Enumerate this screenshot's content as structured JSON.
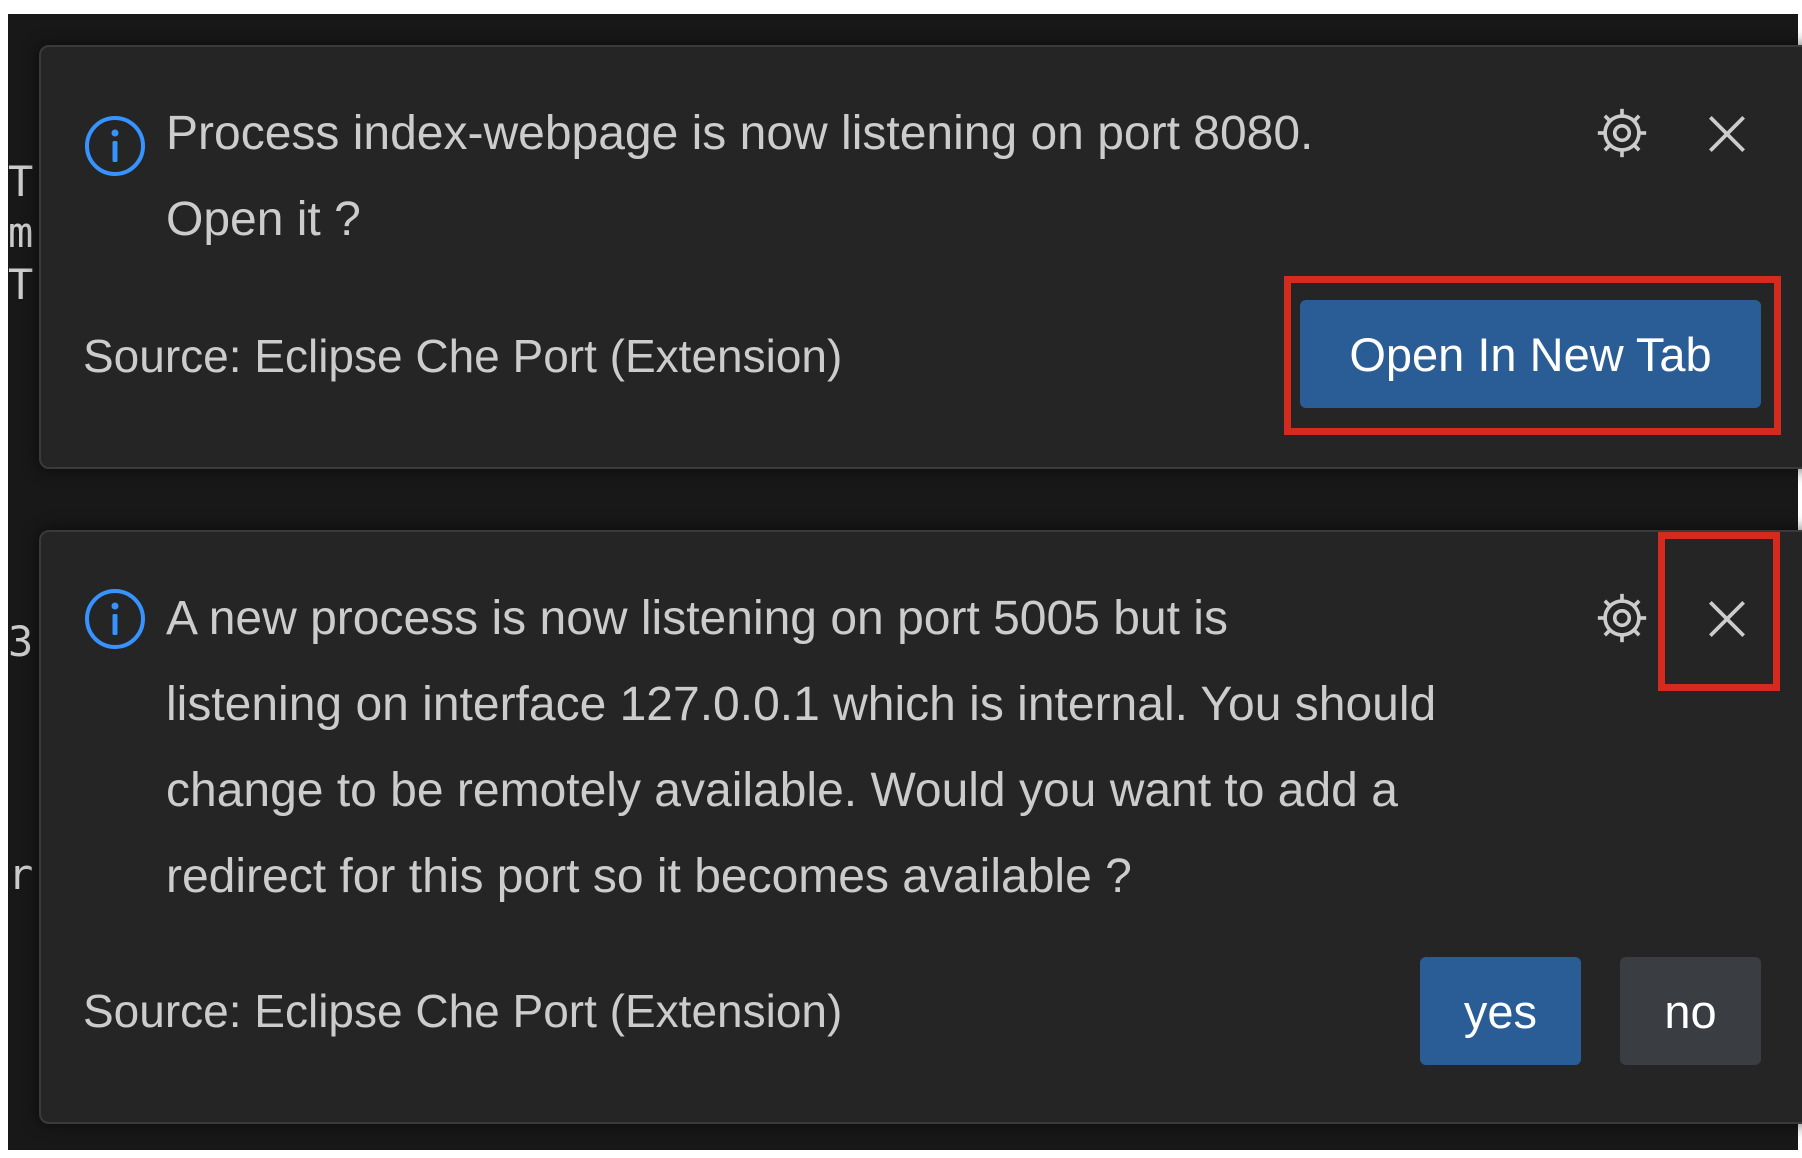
{
  "background_fragments": [
    "T",
    "m(",
    "T",
    "3",
    "r|"
  ],
  "notifications": [
    {
      "icon": "info-icon",
      "message_lines": [
        "Process index-webpage is now listening on port 8080.",
        "Open it ?"
      ],
      "settings_icon": "gear-icon",
      "close_icon": "close-icon",
      "source": "Source: Eclipse Che Port (Extension)",
      "actions": [
        {
          "label": "Open In New Tab",
          "style": "primary"
        }
      ]
    },
    {
      "icon": "info-icon",
      "message_lines": [
        "A new process is now listening on port 5005 but is",
        "listening on interface 127.0.0.1 which is internal. You should",
        "change to be remotely available. Would you want to add a",
        "redirect for this port so it becomes available ?"
      ],
      "settings_icon": "gear-icon",
      "close_icon": "close-icon",
      "source": "Source: Eclipse Che Port (Extension)",
      "actions": [
        {
          "label": "yes",
          "style": "primary"
        },
        {
          "label": "no",
          "style": "secondary"
        }
      ]
    }
  ],
  "colors": {
    "background": "#181818",
    "toast_background": "#252526",
    "text": "#cccccc",
    "info_icon": "#3794ff",
    "primary_button": "#2a5d96",
    "secondary_button": "#3a3d41",
    "highlight_outline": "#d52b1e"
  }
}
